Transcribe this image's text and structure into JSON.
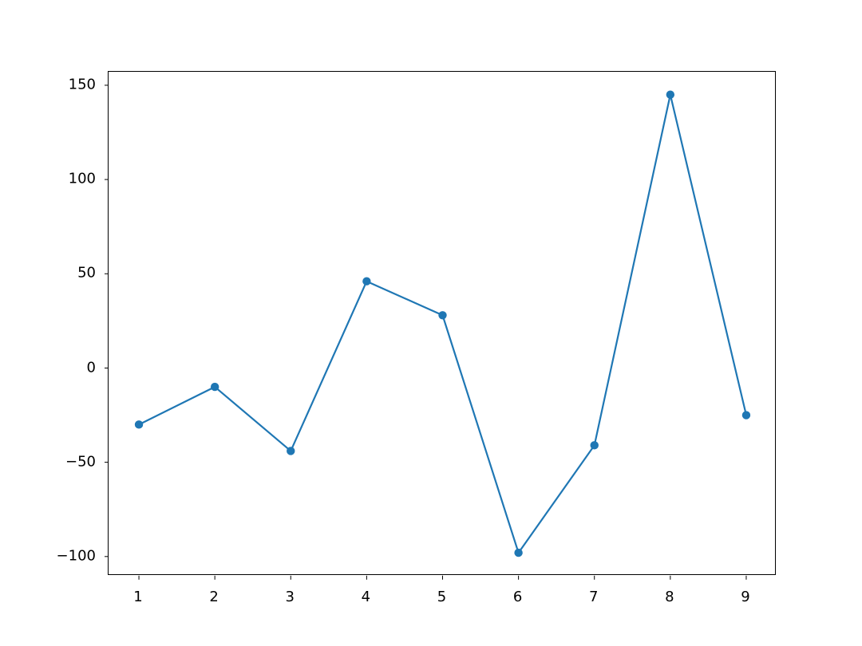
{
  "chart_data": {
    "type": "line",
    "x": [
      1,
      2,
      3,
      4,
      5,
      6,
      7,
      8,
      9
    ],
    "values": [
      -30,
      -10,
      -44,
      46,
      28,
      -98,
      -41,
      145,
      -25
    ],
    "x_ticks": [
      1,
      2,
      3,
      4,
      5,
      6,
      7,
      8,
      9
    ],
    "x_tick_labels": [
      "1",
      "2",
      "3",
      "4",
      "5",
      "6",
      "7",
      "8",
      "9"
    ],
    "y_ticks": [
      -100,
      -50,
      0,
      50,
      100,
      150
    ],
    "y_tick_labels": [
      "−100",
      "−50",
      "0",
      "50",
      "100",
      "150"
    ],
    "xlim": [
      0.6,
      9.4
    ],
    "ylim": [
      -110.15,
      157.15
    ],
    "title": "",
    "xlabel": "",
    "ylabel": "",
    "series_color": "#1f77b4",
    "marker_radius": 5.2,
    "grid": false
  },
  "layout": {
    "fig_w": 1080,
    "fig_h": 810,
    "axes_left": 135,
    "axes_top": 89.1,
    "axes_width": 837,
    "axes_height": 631.8,
    "tick_len": 5,
    "xlabel_offset": 12,
    "ylabel_offset": 10
  }
}
